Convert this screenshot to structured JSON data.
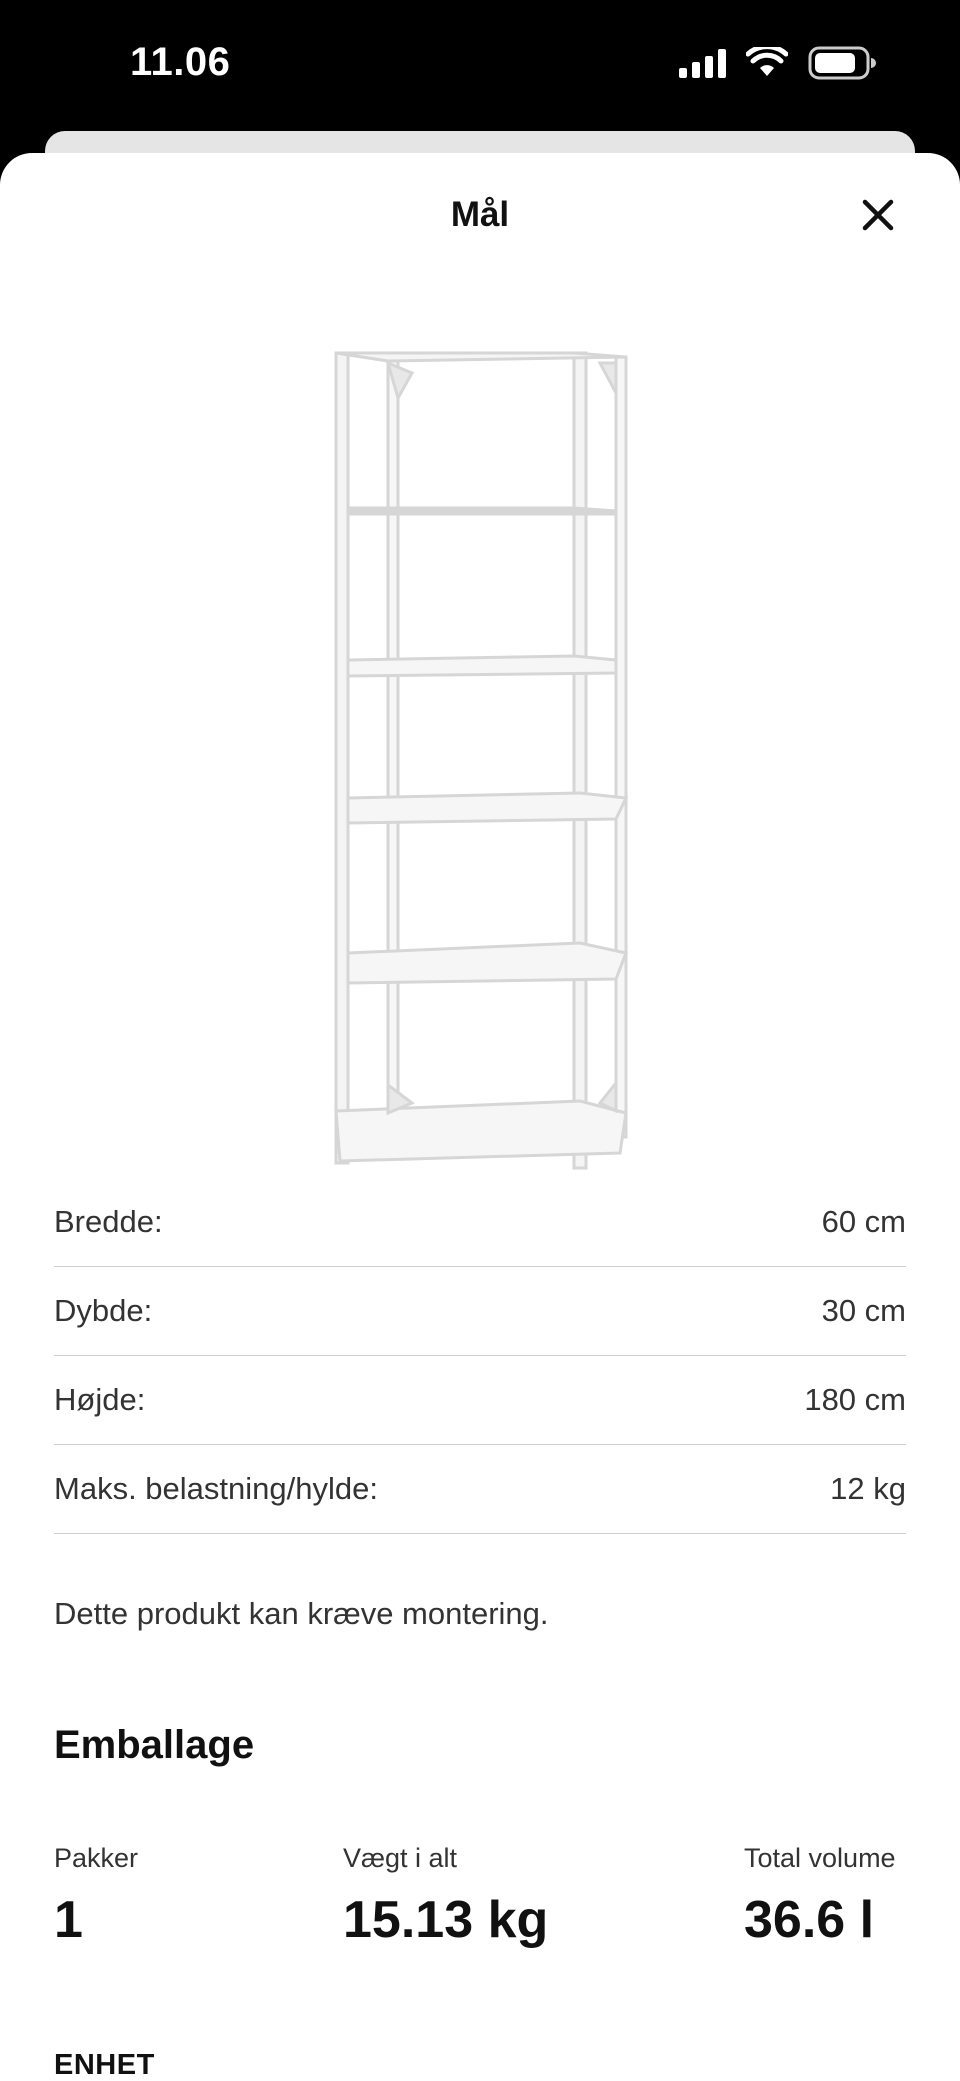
{
  "status_bar": {
    "time": "11.06"
  },
  "sheet": {
    "title": "Mål"
  },
  "dimensions": [
    {
      "label": "Bredde:",
      "value": "60 cm"
    },
    {
      "label": "Dybde:",
      "value": "30 cm"
    },
    {
      "label": "Højde:",
      "value": "180 cm"
    },
    {
      "label": "Maks. belastning/hylde:",
      "value": "12 kg"
    }
  ],
  "assembly_note": "Dette produkt kan kræve montering.",
  "packaging": {
    "heading": "Emballage",
    "stats": [
      {
        "label": "Pakker",
        "value": "1"
      },
      {
        "label": "Vægt i alt",
        "value": "15.13 kg"
      },
      {
        "label": "Total volume",
        "value": "36.6 l"
      }
    ]
  },
  "unit_heading": "ENHET",
  "icons": {
    "close": "close-icon",
    "signal": "cellular-signal-icon",
    "wifi": "wifi-icon",
    "battery": "battery-icon"
  }
}
